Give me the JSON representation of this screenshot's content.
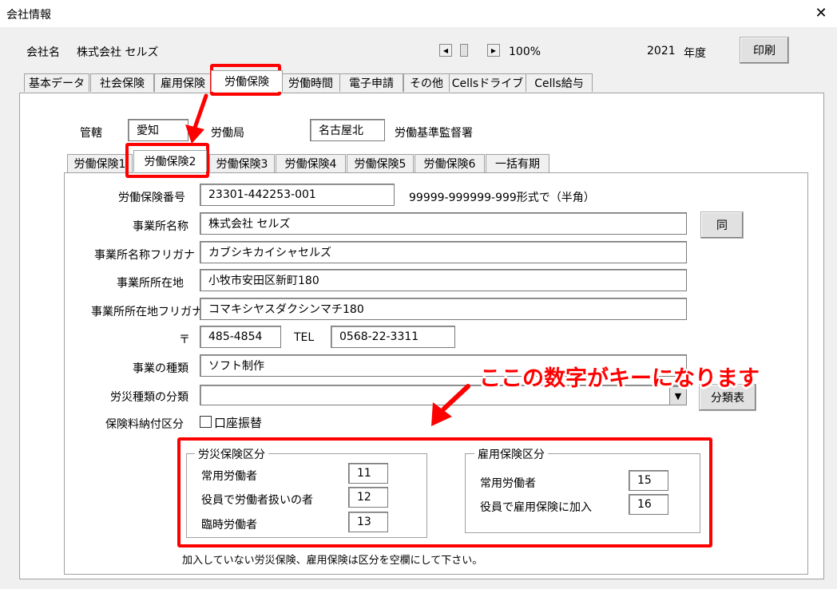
{
  "window": {
    "title": "会社情報",
    "close_glyph": "✕"
  },
  "header": {
    "company_label": "会社名",
    "company_name": "株式会社 セルズ",
    "zoom": "100%",
    "year": "2021",
    "year_unit": "年度",
    "print_label": "印刷"
  },
  "main_tabs": [
    "基本データ",
    "社会保険",
    "雇用保険",
    "労働保険",
    "労働時間",
    "電子申請",
    "その他",
    "Cellsドライブ",
    "Cells給与"
  ],
  "jurisdiction": {
    "label": "管轄",
    "prefecture": "愛知",
    "bureau_label": "労働局",
    "office": "名古屋北",
    "office_label": "労働基準監督署"
  },
  "sub_tabs": [
    "労働保険1",
    "労働保険2",
    "労働保険3",
    "労働保険4",
    "労働保険5",
    "労働保険6",
    "一括有期"
  ],
  "form": {
    "insurance_number_label": "労働保険番号",
    "insurance_number": "23301-442253-001",
    "insurance_number_hint": "99999-999999-999形式で（半角）",
    "office_name_label": "事業所名称",
    "office_name": "株式会社 セルズ",
    "same_button": "同",
    "office_kana_label": "事業所名称フリガナ",
    "office_kana": "カブシキカイシャセルズ",
    "address_label": "事業所所在地",
    "address": "小牧市安田区新町180",
    "address_kana_label": "事業所所在地フリガナ",
    "address_kana": "コマキシヤスダクシンマチ180",
    "postal_label": "〒",
    "postal": "485-4854",
    "tel_label": "TEL",
    "tel": "0568-22-3311",
    "business_type_label": "事業の種類",
    "business_type": "ソフト制作",
    "accident_class_label": "労災種類の分類",
    "accident_class": "",
    "class_table_button": "分類表",
    "payment_label": "保険料納付区分",
    "bank_transfer_label": "口座振替"
  },
  "rosai_group": {
    "title": "労災保険区分",
    "rows": [
      {
        "label": "常用労働者",
        "value": "11"
      },
      {
        "label": "役員で労働者扱いの者",
        "value": "12"
      },
      {
        "label": "臨時労働者",
        "value": "13"
      }
    ]
  },
  "koyo_group": {
    "title": "雇用保険区分",
    "rows": [
      {
        "label": "常用労働者",
        "value": "15"
      },
      {
        "label": "役員で雇用保険に加入",
        "value": "16"
      }
    ]
  },
  "footer_note": "加入していない労災保険、雇用保険は区分を空欄にして下さい。",
  "annotation": "ここの数字がキーになります",
  "colors": {
    "highlight": "#ff0000",
    "window_bg": "#f0f0f0",
    "panel_bg": "#ffffff"
  }
}
